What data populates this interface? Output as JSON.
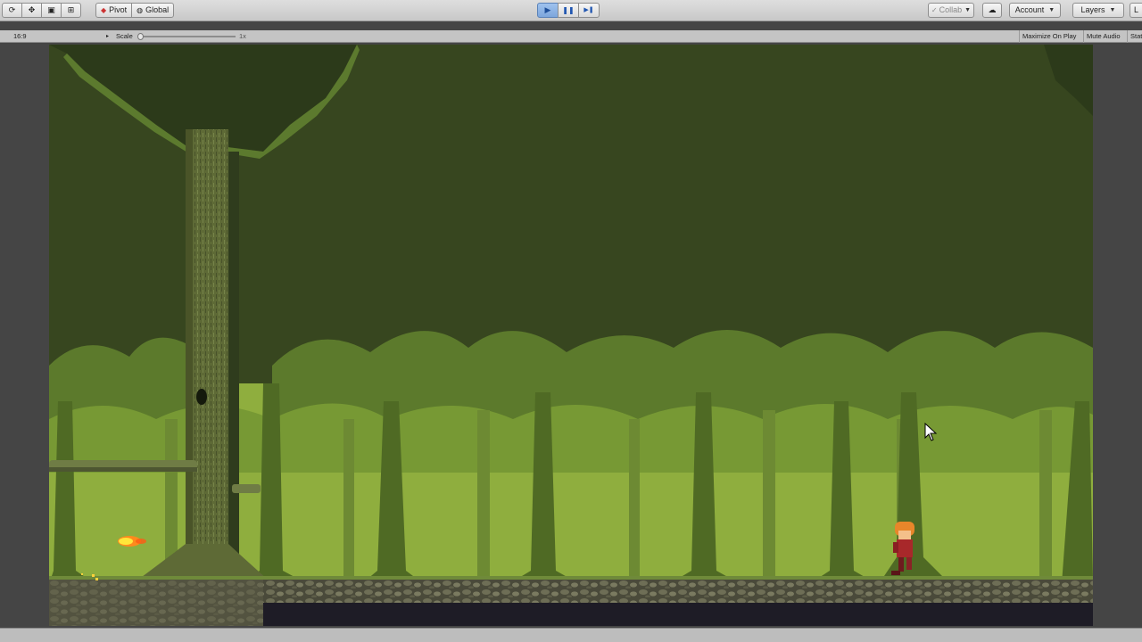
{
  "toolbar": {
    "tools": [
      {
        "name": "hand-tool-icon",
        "glyph": "⟳"
      },
      {
        "name": "move-tool-icon",
        "glyph": "✥"
      },
      {
        "name": "rect-tool-icon",
        "glyph": "▣"
      },
      {
        "name": "transform-tool-icon",
        "glyph": "⊞"
      }
    ],
    "pivot_label": "Pivot",
    "global_label": "Global",
    "play_glyph": "▶",
    "pause_glyph": "❚❚",
    "step_glyph": "▶❚",
    "collab_label": "Collab",
    "account_label": "Account",
    "layers_label": "Layers",
    "layout_label": "L"
  },
  "gamebar": {
    "aspect": "16:9",
    "scale_label": "Scale",
    "scale_value": "1x",
    "maximize_label": "Maximize On Play",
    "mute_label": "Mute Audio",
    "stats_label": "Stats"
  },
  "colors": {
    "sky": "#37461f",
    "canopy_dark": "#2c3a1a",
    "trees_mid": "#5c7a2c",
    "trees_light": "#8fae3e",
    "ground_rock": "#5a5a44",
    "ground_dark": "#1e1c26"
  }
}
